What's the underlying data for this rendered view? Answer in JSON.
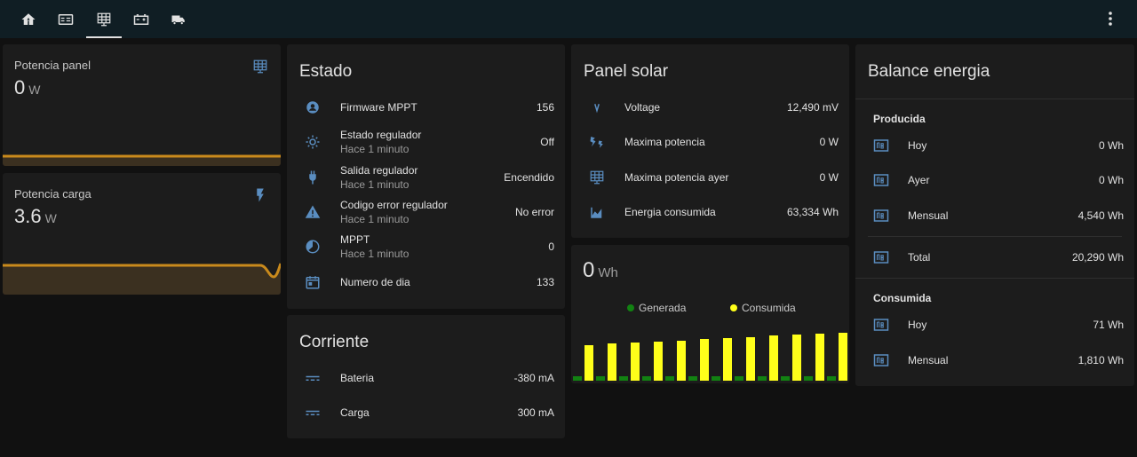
{
  "colors": {
    "accent_icon": "#5a8dc0",
    "graph_line": "#c98a1c",
    "graph_fill": "#3b3020",
    "bar_yellow": "#ffff1a",
    "bar_green": "#128212"
  },
  "tabs": [
    {
      "name": "home-icon"
    },
    {
      "name": "inverter-icon"
    },
    {
      "name": "solar-panel-icon"
    },
    {
      "name": "battery-icon"
    },
    {
      "name": "truck-icon"
    }
  ],
  "potencia_panel": {
    "name": "Potencia panel",
    "value": "0",
    "unit": "W",
    "icon": "solar-panel-icon"
  },
  "potencia_carga": {
    "name": "Potencia carga",
    "value": "3.6",
    "unit": "W",
    "icon": "flash-icon"
  },
  "estado": {
    "title": "Estado",
    "rows": [
      {
        "icon": "chip-icon",
        "name": "Firmware MPPT",
        "sub": "",
        "value": "156"
      },
      {
        "icon": "sun-icon",
        "name": "Estado regulador",
        "sub": "Hace 1 minuto",
        "value": "Off"
      },
      {
        "icon": "plug-icon",
        "name": "Salida regulador",
        "sub": "Hace 1 minuto",
        "value": "Encendido"
      },
      {
        "icon": "alert-icon",
        "name": "Codigo error regulador",
        "sub": "Hace 1 minuto",
        "value": "No error"
      },
      {
        "icon": "gauge-icon",
        "name": "MPPT",
        "sub": "Hace 1 minuto",
        "value": "0"
      },
      {
        "icon": "calendar-icon",
        "name": "Numero de dia",
        "sub": "",
        "value": "133"
      }
    ]
  },
  "corriente": {
    "title": "Corriente",
    "rows": [
      {
        "icon": "current-dc-icon",
        "name": "Bateria",
        "value": "-380 mA"
      },
      {
        "icon": "current-dc-icon",
        "name": "Carga",
        "value": "300 mA"
      }
    ]
  },
  "panel_solar": {
    "title": "Panel solar",
    "rows": [
      {
        "icon": "volt-icon",
        "name": "Voltage",
        "value": "12,490 mV"
      },
      {
        "icon": "power-icon",
        "name": "Maxima potencia",
        "value": "0 W"
      },
      {
        "icon": "solar-panel-icon",
        "name": "Maxima potencia ayer",
        "value": "0 W"
      },
      {
        "icon": "chart-icon",
        "name": "Energia consumida",
        "value": "63,334 Wh"
      }
    ]
  },
  "energia_graph": {
    "value": "0",
    "unit": "Wh",
    "legend": [
      {
        "name": "Generada",
        "color": "#128212"
      },
      {
        "name": "Consumida",
        "color": "#ffff1a"
      }
    ]
  },
  "chart_data": {
    "type": "bar",
    "series": [
      {
        "name": "Generada",
        "values": [
          0,
          0,
          0,
          0,
          0,
          0,
          0,
          0,
          0,
          0,
          0,
          0
        ]
      },
      {
        "name": "Consumida",
        "values": [
          40,
          42,
          43,
          44,
          45,
          47,
          48,
          49,
          51,
          52,
          53,
          54
        ]
      }
    ]
  },
  "balance": {
    "title": "Balance energia",
    "producida_label": "Producida",
    "producida": [
      {
        "icon": "meter-icon",
        "name": "Hoy",
        "value": "0 Wh"
      },
      {
        "icon": "meter-icon",
        "name": "Ayer",
        "value": "0 Wh"
      },
      {
        "icon": "meter-icon",
        "name": "Mensual",
        "value": "4,540 Wh"
      }
    ],
    "total": {
      "icon": "meter-icon",
      "name": "Total",
      "value": "20,290 Wh"
    },
    "consumida_label": "Consumida",
    "consumida": [
      {
        "icon": "meter-icon",
        "name": "Hoy",
        "value": "71 Wh"
      },
      {
        "icon": "meter-icon",
        "name": "Mensual",
        "value": "1,810 Wh"
      }
    ]
  }
}
